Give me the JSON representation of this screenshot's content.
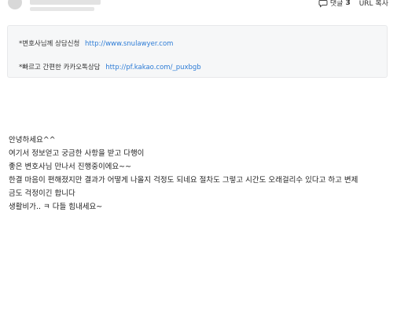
{
  "header": {
    "comment_label": "댓글",
    "comment_count": "3",
    "url_copy_label": "URL 복사"
  },
  "info_box": {
    "line1_prefix": "*변호사님께 상담신청",
    "line1_link": "http://www.snulawyer.com",
    "line2_prefix": "*빠르고 간편한 카카오톡상담",
    "line2_link": "http://pf.kakao.com/_puxbgb"
  },
  "post": {
    "lines": [
      "안녕하세요^^",
      "여기서  정보얻고   궁금한 사항을  받고  다행이",
      "좋은 변호사님 만나서 진행중이에요~~",
      "한결 마음이 편해졌지만  결과가  어떻게 나올지  걱정도 되네요   절차도 그렇고 시간도 오래걸리수 있다고 하고  변제",
      "금도 걱정이긴 합니다",
      "생활비가..  ㅋ 다들  힘내세요~"
    ]
  },
  "icons": {
    "comment": "speech-bubble-icon"
  }
}
